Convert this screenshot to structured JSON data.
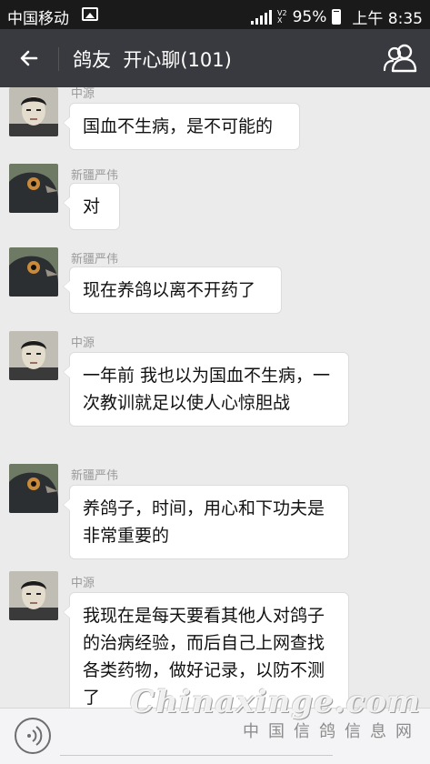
{
  "status_bar": {
    "carrier": "中国移动",
    "network_top": "V2",
    "network_bottom": "X",
    "battery": "95%",
    "time": "上午 8:35"
  },
  "header": {
    "title": "鸽友  开心聊(101)",
    "back_icon": "arrow-left-icon",
    "members_icon": "group-members-icon"
  },
  "messages": [
    {
      "sender": "中源",
      "text": "国血不生病，是不可能的"
    },
    {
      "sender": "新疆严伟",
      "text": "对"
    },
    {
      "sender": "新疆严伟",
      "text": "现在养鸽以离不开药了"
    },
    {
      "sender": "中源",
      "text": "一年前 我也以为国血不生病，一次教训就足以使人心惊胆战"
    },
    {
      "sender": "新疆严伟",
      "text": "养鸽子，时间，用心和下功夫是非常重要的"
    },
    {
      "sender": "中源",
      "text": "我现在是每天要看其他人对鸽子的治病经验，而后自己上网查找各类药物，做好记录，以防不测了"
    }
  ],
  "input_bar": {
    "voice_icon": "voice-input-icon",
    "value": ""
  },
  "watermark": {
    "main": "Chinaxinge.com",
    "sub": "中国信鸽信息网"
  },
  "colors": {
    "title_bar": "#393a3f",
    "background": "#ebebeb",
    "bubble": "#ffffff"
  }
}
